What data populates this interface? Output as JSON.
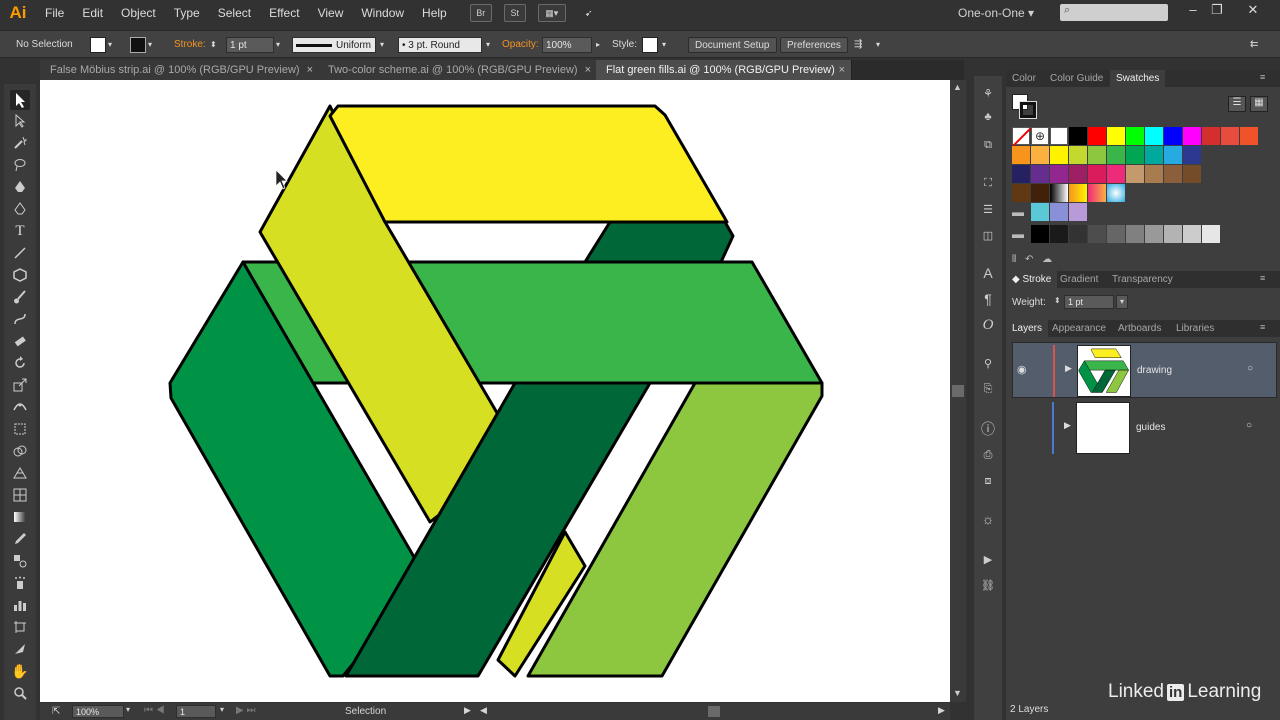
{
  "app": {
    "logo": "Ai"
  },
  "menu": [
    "File",
    "Edit",
    "Object",
    "Type",
    "Select",
    "Effect",
    "View",
    "Window",
    "Help"
  ],
  "menubar_buttons": [
    "Br",
    "St"
  ],
  "workspace": "One-on-One",
  "control": {
    "selection": "No Selection",
    "stroke_label": "Stroke:",
    "stroke_weight": "1 pt",
    "stroke_profile": "Uniform",
    "brush": "3 pt. Round",
    "opacity_label": "Opacity:",
    "opacity_value": "100%",
    "style_label": "Style:",
    "doc_setup": "Document Setup",
    "preferences": "Preferences"
  },
  "tabs": [
    {
      "label": "False Möbius strip.ai @ 100% (RGB/GPU Preview)"
    },
    {
      "label": "Two-color scheme.ai @ 100% (RGB/GPU Preview)"
    },
    {
      "label": "Flat green fills.ai @ 100% (RGB/GPU Preview)"
    }
  ],
  "status": {
    "zoom": "100%",
    "artboard": "1",
    "tool": "Selection"
  },
  "panel_tabs_top": [
    "Color",
    "Color Guide",
    "Swatches"
  ],
  "panel_tabs_stroke": [
    "Stroke",
    "Gradient",
    "Transparency"
  ],
  "stroke_panel": {
    "weight_label": "Weight:",
    "weight_value": "1 pt"
  },
  "panel_tabs_layers": [
    "Layers",
    "Appearance",
    "Artboards",
    "Libraries"
  ],
  "layers": [
    {
      "name": "drawing",
      "color": "#d9534f"
    },
    {
      "name": "guides",
      "color": "#4a7bd1"
    }
  ],
  "layers_count": "2 Layers",
  "swatch_rows": [
    [
      "#000000",
      "#ff0000",
      "#ffff00",
      "#00ff00",
      "#00ffff",
      "#0000ff",
      "#ff00ff",
      "#d42e2e",
      "#e84c3d",
      "#f0522a"
    ],
    [
      "#f7941d",
      "#fbb040",
      "#fff200",
      "#c4d82e",
      "#8dc63f",
      "#39b54a",
      "#00a651",
      "#00a99d",
      "#27aae1",
      "#2b3990"
    ],
    [
      "#262262",
      "#662d91",
      "#92278f",
      "#9e1f63",
      "#da1c5c",
      "#ee2a7b",
      "#c49a6c",
      "#a97c50",
      "#8b5e3c",
      "#754c29"
    ],
    [
      "#603913",
      "#42210b"
    ],
    [
      "#000000",
      "#1a1a1a",
      "#333333",
      "#4d4d4d",
      "#666666",
      "#808080",
      "#999999",
      "#b3b3b3",
      "#cccccc",
      "#e6e6e6"
    ]
  ],
  "watermark": {
    "brand": "Linked",
    "in": "in",
    "suffix": "Learning"
  }
}
